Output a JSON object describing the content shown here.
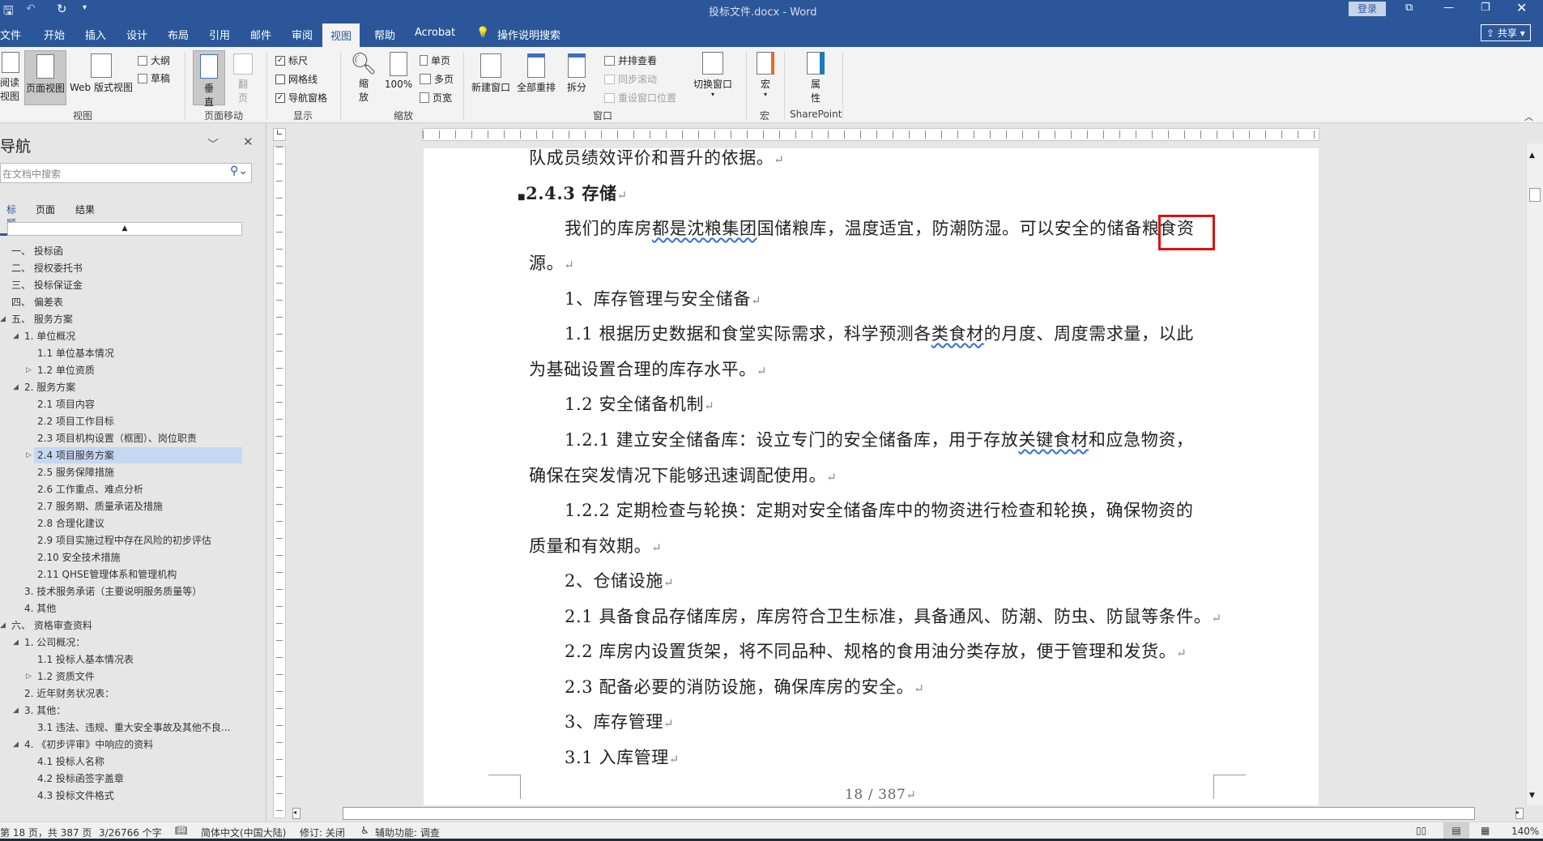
{
  "titlebar": {
    "title": "投标文件.docx  -  Word",
    "login": "登录",
    "share": "共享"
  },
  "tabs": [
    "文件",
    "开始",
    "插入",
    "设计",
    "布局",
    "引用",
    "邮件",
    "审阅",
    "视图",
    "帮助",
    "Acrobat"
  ],
  "tell_me": "操作说明搜索",
  "ribbon": {
    "views": {
      "read": "阅读视图",
      "print": "页面视图",
      "web": "Web 版式视图",
      "outline": "大纲",
      "draft": "草稿",
      "label": "视图"
    },
    "page_move": {
      "vertical": "垂直",
      "side": "翻页",
      "label": "页面移动"
    },
    "show": {
      "ruler": "标尺",
      "gridlines": "网格线",
      "navpane": "导航窗格",
      "label": "显示",
      "ruler_checked": true,
      "grid_checked": false,
      "nav_checked": true
    },
    "zoom": {
      "zoom": "缩放",
      "hundred": "100%",
      "one": "单页",
      "multi": "多页",
      "width": "页宽",
      "label": "缩放"
    },
    "window": {
      "new": "新建窗口",
      "arrange": "全部重排",
      "split": "拆分",
      "side": "并排查看",
      "sync": "同步滚动",
      "reset": "重设窗口位置",
      "switch": "切换窗口",
      "label": "窗口"
    },
    "macros": {
      "macro": "宏",
      "label": "宏"
    },
    "sharepoint": {
      "props": "属性",
      "label": "SharePoint"
    }
  },
  "nav": {
    "title": "导航",
    "search_placeholder": "在文档中搜索",
    "tabs": [
      "标题",
      "页面",
      "结果"
    ],
    "items": [
      {
        "t": "一、 投标函",
        "l": 0,
        "e": ""
      },
      {
        "t": "二、 授权委托书",
        "l": 0,
        "e": ""
      },
      {
        "t": "三、 投标保证金",
        "l": 0,
        "e": ""
      },
      {
        "t": "四、 偏差表",
        "l": 0,
        "e": ""
      },
      {
        "t": "五、 服务方案",
        "l": 0,
        "e": "open"
      },
      {
        "t": "1. 单位概况",
        "l": 1,
        "e": "open"
      },
      {
        "t": "1.1  单位基本情况",
        "l": 2,
        "e": ""
      },
      {
        "t": "1.2  单位资质",
        "l": 2,
        "e": "closed"
      },
      {
        "t": "2. 服务方案",
        "l": 1,
        "e": "open"
      },
      {
        "t": "2.1  项目内容",
        "l": 2,
        "e": ""
      },
      {
        "t": "2.2  项目工作目标",
        "l": 2,
        "e": ""
      },
      {
        "t": "2.3  项目机构设置（框图）、岗位职责",
        "l": 2,
        "e": ""
      },
      {
        "t": "2.4  项目服务方案",
        "l": 2,
        "e": "closed",
        "sel": true
      },
      {
        "t": "2.5  服务保障措施",
        "l": 2,
        "e": ""
      },
      {
        "t": "2.6  工作重点、难点分析",
        "l": 2,
        "e": ""
      },
      {
        "t": "2.7  服务期、质量承诺及措施",
        "l": 2,
        "e": ""
      },
      {
        "t": "2.8  合理化建议",
        "l": 2,
        "e": ""
      },
      {
        "t": "2.9  项目实施过程中存在风险的初步评估",
        "l": 2,
        "e": ""
      },
      {
        "t": "2.10  安全技术措施",
        "l": 2,
        "e": ""
      },
      {
        "t": "2.11  QHSE管理体系和管理机构",
        "l": 2,
        "e": ""
      },
      {
        "t": "3. 技术服务承诺（主要说明服务质量等）",
        "l": 1,
        "e": ""
      },
      {
        "t": "4. 其他",
        "l": 1,
        "e": ""
      },
      {
        "t": "六、 资格审查资料",
        "l": 0,
        "e": "open"
      },
      {
        "t": "1. 公司概况：",
        "l": 1,
        "e": "open"
      },
      {
        "t": "1.1  投标人基本情况表",
        "l": 2,
        "e": ""
      },
      {
        "t": "1.2  资质文件",
        "l": 2,
        "e": "closed"
      },
      {
        "t": "2. 近年财务状况表：",
        "l": 1,
        "e": ""
      },
      {
        "t": "3. 其他：",
        "l": 1,
        "e": "open"
      },
      {
        "t": "3.1  违法、违规、重大安全事故及其他不良...",
        "l": 2,
        "e": ""
      },
      {
        "t": "4. 《初步评审》中响应的资料",
        "l": 1,
        "e": "open"
      },
      {
        "t": "4.1  投标人名称",
        "l": 2,
        "e": ""
      },
      {
        "t": "4.2  投标函签字盖章",
        "l": 2,
        "e": ""
      },
      {
        "t": "4.3  投标文件格式",
        "l": 2,
        "e": ""
      }
    ]
  },
  "doc": {
    "l1": "队成员绩效评价和晋升的依据。",
    "heading": "2.4.3  存储",
    "p1a": "我们的库房",
    "p1u": "都是沈粮集团",
    "p1b": "国储粮库，温度适宜，防潮防湿。可以安全的储备",
    "p1c": "粮食资",
    "p1d": "源。",
    "l4": "1、库存管理与安全储备",
    "l5a": "1.1 根据历史数据和食堂实际需求，科学预测各",
    "l5u": "类食材",
    "l5b": "的月度、周度需求量，以此",
    "l6": "为基础设置合理的库存水平。",
    "l7": "1.2 安全储备机制",
    "l8a": "1.2.1  建立安全储备库：设立专门的安全储备库，用于存放",
    "l8u": "关键食材",
    "l8b": "和应急物资，",
    "l9": "确保在突发情况下能够迅速调配使用。",
    "l10": "1.2.2 定期检查与轮换：定期对安全储备库中的物资进行检查和轮换，确保物资的",
    "l11": "质量和有效期。",
    "l12": "2、仓储设施",
    "l13": "2.1 具备食品存储库房，库房符合卫生标准，具备通风、防潮、防虫、防鼠等条件。",
    "l14": "2.2 库房内设置货架，将不同品种、规格的食用油分类存放，便于管理和发货。",
    "l15": "2.3 配备必要的消防设施，确保库房的安全。",
    "l16": "3、库存管理",
    "l17": "3.1 入库管理",
    "page_num": "18 / 387"
  },
  "status": {
    "page": "第 18 页，共 387 页",
    "words": "3/26766 个字",
    "lang": "简体中文(中国大陆)",
    "track": "修订: 关闭",
    "access": "辅助功能: 调查",
    "zoom": "140%"
  }
}
